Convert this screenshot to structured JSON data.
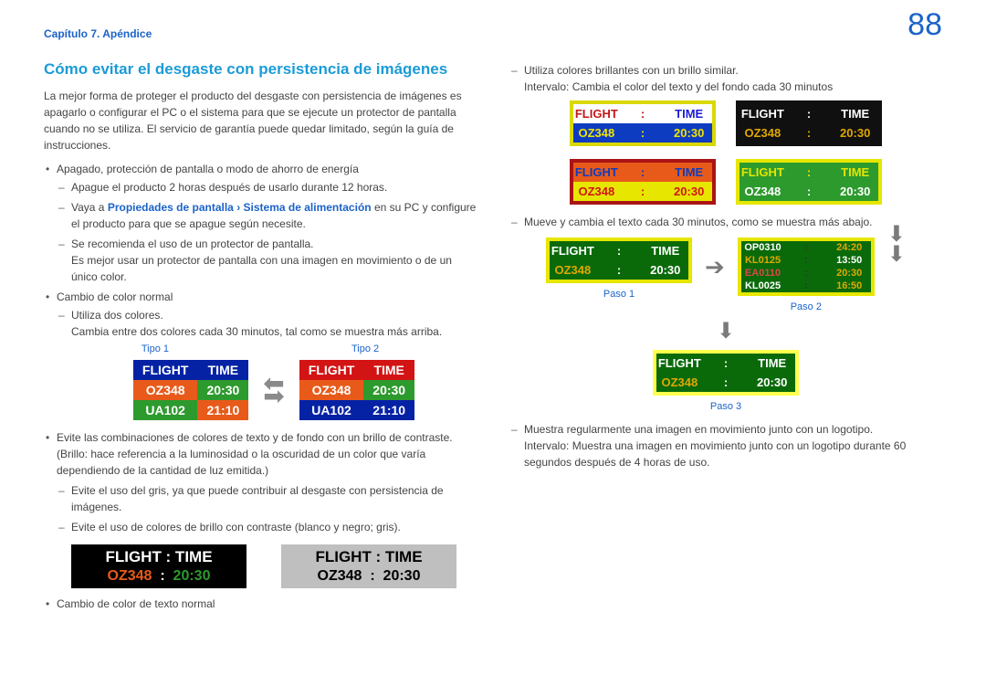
{
  "header": {
    "chapter": "Capítulo 7. Apéndice",
    "page_number": "88"
  },
  "h2": "Cómo evitar el desgaste con persistencia de imágenes",
  "intro": "La mejor forma de proteger el producto del desgaste con persistencia de imágenes es apagarlo o configurar el PC o el sistema para que se ejecute un protector de pantalla cuando no se utiliza. El servicio de garantía puede quedar limitado, según la guía de instrucciones.",
  "bullets": {
    "b1": "Apagado, protección de pantalla o modo de ahorro de energía",
    "b1_d1": "Apague el producto 2 horas después de usarlo durante 12 horas.",
    "b1_d2_pre": "Vaya a ",
    "b1_d2_link1": "Propiedades de pantalla",
    "b1_d2_caret": "›",
    "b1_d2_link2": "Sistema de alimentación",
    "b1_d2_post": " en su PC y configure el producto para que se apague según necesite.",
    "b1_d3a": "Se recomienda el uso de un protector de pantalla.",
    "b1_d3b": "Es mejor usar un protector de pantalla con una imagen en movimiento o de un único color.",
    "b2": "Cambio de color normal",
    "b2_d1a": "Utiliza dos colores.",
    "b2_d1b": "Cambia entre dos colores cada 30 minutos, tal como se muestra más arriba.",
    "b3": "Evite las combinaciones de colores de texto y de fondo con un brillo de contraste. (Brillo: hace referencia a la luminosidad o la oscuridad de un color que varía dependiendo de la cantidad de luz emitida.)",
    "b3_d1": "Evite el uso del gris, ya que puede contribuir al desgaste con persistencia de imágenes.",
    "b3_d2": "Evite el uso de colores de brillo con contraste (blanco y negro; gris).",
    "b4": "Cambio de color de texto normal"
  },
  "tipo_labels": {
    "t1": "Tipo 1",
    "t2": "Tipo 2"
  },
  "ft": {
    "h_flight": "FLIGHT",
    "h_time": "TIME",
    "r1_code": "OZ348",
    "r1_time": "20:30",
    "r2_code": "UA102",
    "r2_time": "21:10"
  },
  "bw": {
    "top": "FLIGHT  :  TIME",
    "fl": "OZ348",
    "sep": ":",
    "tm": "20:30"
  },
  "right": {
    "d1a": "Utiliza colores brillantes con un brillo similar.",
    "d1b": "Intervalo: Cambia el color del texto y del fondo cada 30 minutos",
    "d2": "Mueve y cambia el texto cada 30 minutos, como se muestra más abajo.",
    "d3a": "Muestra regularmente una imagen en movimiento junto con un logotipo.",
    "d3b": "Intervalo: Muestra una imagen en movimiento junto con un logotipo durante 60 segundos después de 4 horas de uso."
  },
  "panel": {
    "r1": "FLIGHT   :   TIME",
    "r2_c": "OZ348",
    "r2_s": ":",
    "r2_t": "20:30"
  },
  "steps": {
    "s1": "Paso 1",
    "s2": "Paso 2",
    "s3": "Paso 3"
  },
  "scroll": {
    "a_c": "OP0310",
    "a_t": "24:20",
    "b_c": "KL0125",
    "b_t": "13:50",
    "c_c": "EA0110",
    "c_t": "20:30",
    "d_c": "KL0025",
    "d_t": "16:50"
  }
}
